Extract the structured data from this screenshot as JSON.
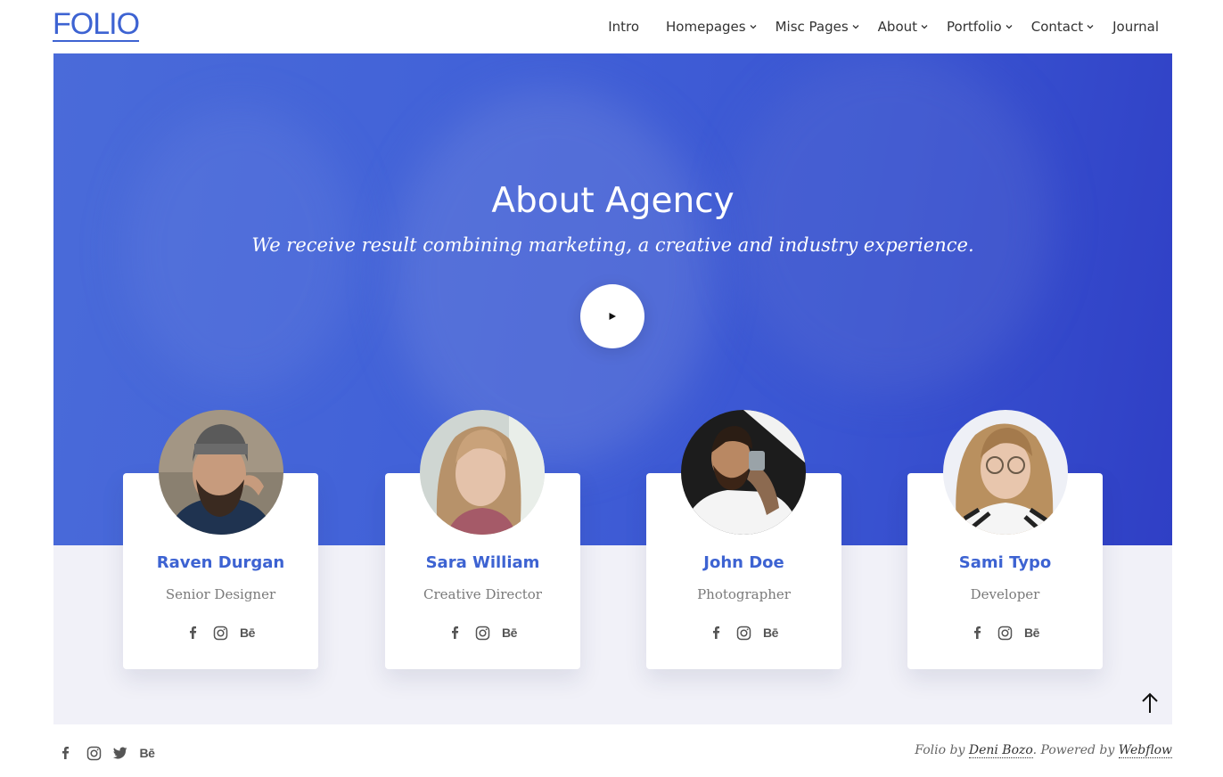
{
  "brand": {
    "logo": "FOLIO",
    "accent": "#3d63d2"
  },
  "nav": {
    "items": [
      {
        "label": "Intro",
        "dropdown": false
      },
      {
        "label": "Homepages",
        "dropdown": true
      },
      {
        "label": "Misc Pages",
        "dropdown": true
      },
      {
        "label": "About",
        "dropdown": true
      },
      {
        "label": "Portfolio",
        "dropdown": true
      },
      {
        "label": "Contact",
        "dropdown": true
      },
      {
        "label": "Journal",
        "dropdown": false
      }
    ]
  },
  "hero": {
    "title": "About Agency",
    "subtitle": "We receive result combining marketing, a creative and industry experience.",
    "play_icon": "play-icon",
    "color": "#4262d8"
  },
  "team": [
    {
      "name": "Raven Durgan",
      "role": "Senior Designer",
      "socials": [
        "facebook-icon",
        "instagram-icon",
        "behance-icon"
      ]
    },
    {
      "name": "Sara William",
      "role": "Creative Director",
      "socials": [
        "facebook-icon",
        "instagram-icon",
        "behance-icon"
      ]
    },
    {
      "name": "John Doe",
      "role": "Photographer",
      "socials": [
        "facebook-icon",
        "instagram-icon",
        "behance-icon"
      ]
    },
    {
      "name": "Sami Typo",
      "role": "Developer",
      "socials": [
        "facebook-icon",
        "instagram-icon",
        "behance-icon"
      ]
    }
  ],
  "behance_label": "Bē",
  "back_to_top_icon": "arrow-up-icon",
  "footer": {
    "socials": [
      "facebook-icon",
      "instagram-icon",
      "twitter-icon",
      "behance-icon"
    ],
    "credit_prefix": "Folio by ",
    "author": "Deni Bozo",
    "credit_middle": ". Powered by ",
    "platform": "Webflow"
  }
}
